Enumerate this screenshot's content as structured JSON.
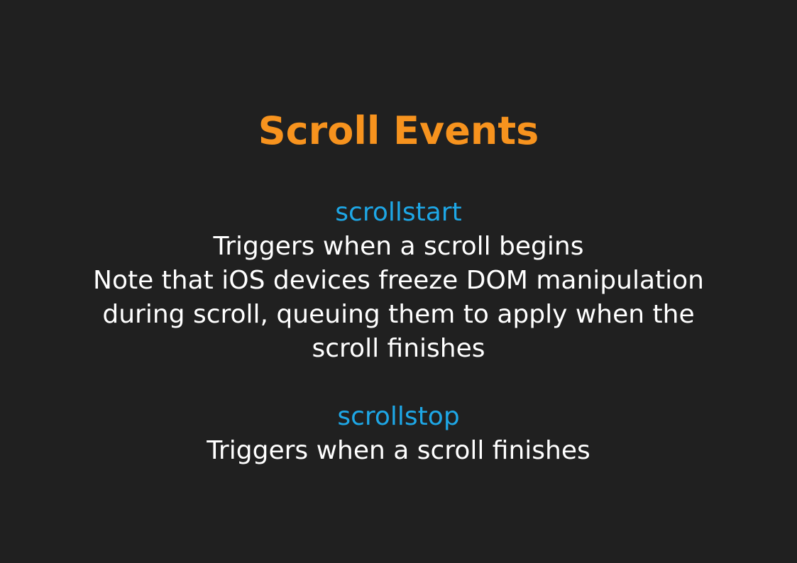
{
  "slide": {
    "title": "Scroll Events",
    "events": [
      {
        "name": "scrollstart",
        "lines": [
          "Triggers when a scroll begins",
          "Note that iOS devices freeze DOM manipulation",
          "during scroll, queuing them to apply when the",
          "scroll finishes"
        ]
      },
      {
        "name": "scrollstop",
        "lines": [
          "Triggers when a scroll finishes"
        ]
      }
    ]
  },
  "colors": {
    "background": "#202020",
    "title": "#f7931e",
    "event_name": "#1ea7e6",
    "body_text": "#ffffff"
  }
}
